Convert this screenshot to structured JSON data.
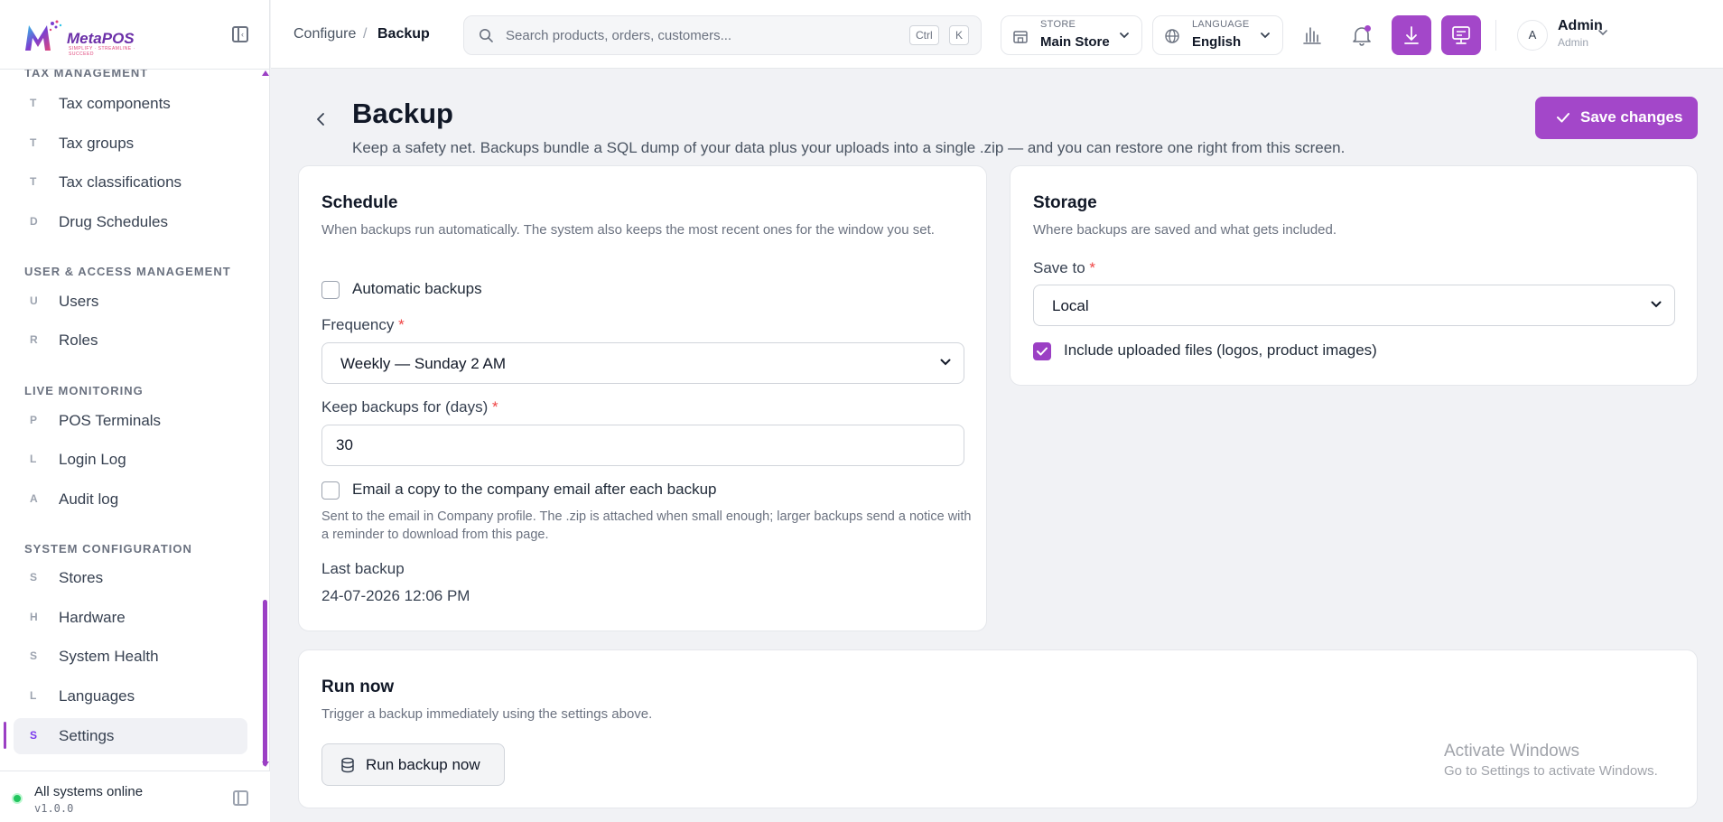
{
  "brand": {
    "name": "MetaPOS",
    "tagline": "SIMPLIFY · STREAMLINE · SUCCEED",
    "accent": "#a347c9"
  },
  "sidebar": {
    "sections": [
      {
        "title": "Tax management",
        "items": [
          {
            "letter": "T",
            "label": "Tax components"
          },
          {
            "letter": "T",
            "label": "Tax groups"
          },
          {
            "letter": "T",
            "label": "Tax classifications"
          },
          {
            "letter": "D",
            "label": "Drug Schedules"
          }
        ]
      },
      {
        "title": "User & access management",
        "items": [
          {
            "letter": "U",
            "label": "Users"
          },
          {
            "letter": "R",
            "label": "Roles"
          }
        ]
      },
      {
        "title": "Live monitoring",
        "items": [
          {
            "letter": "P",
            "label": "POS Terminals"
          },
          {
            "letter": "L",
            "label": "Login Log"
          },
          {
            "letter": "A",
            "label": "Audit log"
          }
        ]
      },
      {
        "title": "System configuration",
        "items": [
          {
            "letter": "S",
            "label": "Stores"
          },
          {
            "letter": "H",
            "label": "Hardware"
          },
          {
            "letter": "S",
            "label": "System Health"
          },
          {
            "letter": "L",
            "label": "Languages"
          },
          {
            "letter": "S",
            "label": "Settings",
            "active": true
          }
        ]
      }
    ],
    "status": {
      "text": "All systems online",
      "version": "v1.0.0",
      "color": "#22c55e"
    }
  },
  "header": {
    "breadcrumb": [
      "Configure",
      "Backup"
    ],
    "breadcrumb_sep": "/",
    "search": {
      "placeholder": "Search products, orders, customers...",
      "kbd": [
        "Ctrl",
        "K"
      ]
    },
    "store": {
      "label": "Store",
      "value": "Main Store"
    },
    "language": {
      "label": "Language",
      "value": "English"
    },
    "user": {
      "initial": "A",
      "name": "Admin",
      "role": "Admin"
    }
  },
  "page": {
    "title": "Backup",
    "description": "Keep a safety net. Backups bundle a SQL dump of your data plus your uploads into a single .zip — and you can restore one right from this screen.",
    "save_label": "Save changes"
  },
  "schedule": {
    "title": "Schedule",
    "description": "When backups run automatically. The system also keeps the most recent ones for the window you set.",
    "auto_label": "Automatic backups",
    "auto_checked": false,
    "frequency_label": "Frequency",
    "frequency_value": "Weekly — Sunday 2 AM",
    "keep_label": "Keep backups for (days)",
    "keep_value": "30",
    "email_label": "Email a copy to the company email after each backup",
    "email_checked": false,
    "email_hint": "Sent to the email in Company profile. The .zip is attached when small enough; larger backups send a notice with a reminder to download from this page.",
    "last_label": "Last backup",
    "last_value": "24-07-2026 12:06 PM"
  },
  "storage": {
    "title": "Storage",
    "description": "Where backups are saved and what gets included.",
    "save_to_label": "Save to",
    "save_to_value": "Local",
    "include_label": "Include uploaded files (logos, product images)",
    "include_checked": true
  },
  "run_now": {
    "title": "Run now",
    "description": "Trigger a backup immediately using the settings above.",
    "button_label": "Run backup now"
  },
  "watermark": {
    "line1": "Activate Windows",
    "line2": "Go to Settings to activate Windows."
  }
}
